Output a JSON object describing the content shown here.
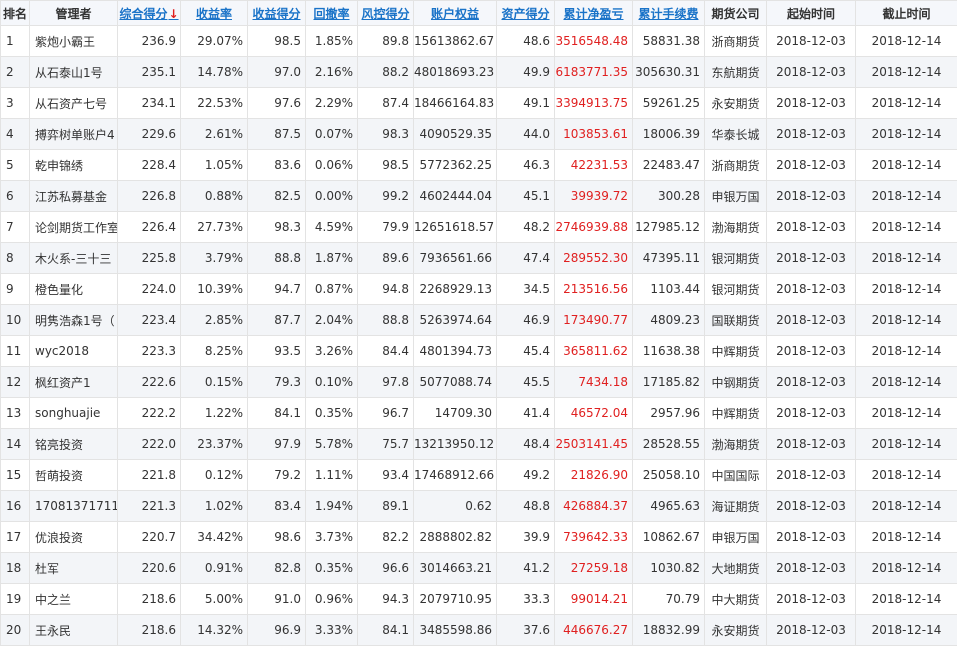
{
  "columns": [
    {
      "label": "排名",
      "sortable": false
    },
    {
      "label": "管理者",
      "sortable": false
    },
    {
      "label": "综合得分",
      "sortable": true,
      "sorted": true
    },
    {
      "label": "收益率",
      "sortable": true
    },
    {
      "label": "收益得分",
      "sortable": true
    },
    {
      "label": "回撤率",
      "sortable": true
    },
    {
      "label": "风控得分",
      "sortable": true
    },
    {
      "label": "账户权益",
      "sortable": true
    },
    {
      "label": "资产得分",
      "sortable": true
    },
    {
      "label": "累计净盈亏",
      "sortable": true
    },
    {
      "label": "累计手续费",
      "sortable": true
    },
    {
      "label": "期货公司",
      "sortable": false
    },
    {
      "label": "起始时间",
      "sortable": false
    },
    {
      "label": "截止时间",
      "sortable": false
    }
  ],
  "sort_arrow": "↓",
  "accent_colors": {
    "link": "#1a73c8",
    "profit": "#e02020",
    "stripe": "#f3f5f8"
  },
  "rows": [
    [
      "1",
      "紫炮小霸王",
      "236.9",
      "29.07%",
      "98.5",
      "1.85%",
      "89.8",
      "15613862.67",
      "48.6",
      "3516548.48",
      "58831.38",
      "浙商期货",
      "2018-12-03",
      "2018-12-14"
    ],
    [
      "2",
      "从石泰山1号",
      "235.1",
      "14.78%",
      "97.0",
      "2.16%",
      "88.2",
      "48018693.23",
      "49.9",
      "6183771.35",
      "305630.31",
      "东航期货",
      "2018-12-03",
      "2018-12-14"
    ],
    [
      "3",
      "从石资产七号",
      "234.1",
      "22.53%",
      "97.6",
      "2.29%",
      "87.4",
      "18466164.83",
      "49.1",
      "3394913.75",
      "59261.25",
      "永安期货",
      "2018-12-03",
      "2018-12-14"
    ],
    [
      "4",
      "搏弈树单账户4",
      "229.6",
      "2.61%",
      "87.5",
      "0.07%",
      "98.3",
      "4090529.35",
      "44.0",
      "103853.61",
      "18006.39",
      "华泰长城",
      "2018-12-03",
      "2018-12-14"
    ],
    [
      "5",
      "乾申锦绣",
      "228.4",
      "1.05%",
      "83.6",
      "0.06%",
      "98.5",
      "5772362.25",
      "46.3",
      "42231.53",
      "22483.47",
      "浙商期货",
      "2018-12-03",
      "2018-12-14"
    ],
    [
      "6",
      "江苏私募基金",
      "226.8",
      "0.88%",
      "82.5",
      "0.00%",
      "99.2",
      "4602444.04",
      "45.1",
      "39939.72",
      "300.28",
      "申银万国",
      "2018-12-03",
      "2018-12-14"
    ],
    [
      "7",
      "论剑期货工作室",
      "226.4",
      "27.73%",
      "98.3",
      "4.59%",
      "79.9",
      "12651618.57",
      "48.2",
      "2746939.88",
      "127985.12",
      "渤海期货",
      "2018-12-03",
      "2018-12-14"
    ],
    [
      "8",
      "木火系-三十三",
      "225.8",
      "3.79%",
      "88.8",
      "1.87%",
      "89.6",
      "7936561.66",
      "47.4",
      "289552.30",
      "47395.11",
      "银河期货",
      "2018-12-03",
      "2018-12-14"
    ],
    [
      "9",
      "橙色量化",
      "224.0",
      "10.39%",
      "94.7",
      "0.87%",
      "94.8",
      "2268929.13",
      "34.5",
      "213516.56",
      "1103.44",
      "银河期货",
      "2018-12-03",
      "2018-12-14"
    ],
    [
      "10",
      "明隽浩森1号（",
      "223.4",
      "2.85%",
      "87.7",
      "2.04%",
      "88.8",
      "5263974.64",
      "46.9",
      "173490.77",
      "4809.23",
      "国联期货",
      "2018-12-03",
      "2018-12-14"
    ],
    [
      "11",
      "wyc2018",
      "223.3",
      "8.25%",
      "93.5",
      "3.26%",
      "84.4",
      "4801394.73",
      "45.4",
      "365811.62",
      "11638.38",
      "中辉期货",
      "2018-12-03",
      "2018-12-14"
    ],
    [
      "12",
      "枫红资产1",
      "222.6",
      "0.15%",
      "79.3",
      "0.10%",
      "97.8",
      "5077088.74",
      "45.5",
      "7434.18",
      "17185.82",
      "中钢期货",
      "2018-12-03",
      "2018-12-14"
    ],
    [
      "13",
      "songhuajie",
      "222.2",
      "1.22%",
      "84.1",
      "0.35%",
      "96.7",
      "14709.30",
      "41.4",
      "46572.04",
      "2957.96",
      "中辉期货",
      "2018-12-03",
      "2018-12-14"
    ],
    [
      "14",
      "铭亮投资",
      "222.0",
      "23.37%",
      "97.9",
      "5.78%",
      "75.7",
      "13213950.12",
      "48.4",
      "2503141.45",
      "28528.55",
      "渤海期货",
      "2018-12-03",
      "2018-12-14"
    ],
    [
      "15",
      "哲萌投资",
      "221.8",
      "0.12%",
      "79.2",
      "1.11%",
      "93.4",
      "17468912.66",
      "49.2",
      "21826.90",
      "25058.10",
      "中国国际",
      "2018-12-03",
      "2018-12-14"
    ],
    [
      "16",
      "17081371711",
      "221.3",
      "1.02%",
      "83.4",
      "1.94%",
      "89.1",
      "0.62",
      "48.8",
      "426884.37",
      "4965.63",
      "海证期货",
      "2018-12-03",
      "2018-12-14"
    ],
    [
      "17",
      "优浪投资",
      "220.7",
      "34.42%",
      "98.6",
      "3.73%",
      "82.2",
      "2888802.82",
      "39.9",
      "739642.33",
      "10862.67",
      "申银万国",
      "2018-12-03",
      "2018-12-14"
    ],
    [
      "18",
      "杜军",
      "220.6",
      "0.91%",
      "82.8",
      "0.35%",
      "96.6",
      "3014663.21",
      "41.2",
      "27259.18",
      "1030.82",
      "大地期货",
      "2018-12-03",
      "2018-12-14"
    ],
    [
      "19",
      "中之兰",
      "218.6",
      "5.00%",
      "91.0",
      "0.96%",
      "94.3",
      "2079710.95",
      "33.3",
      "99014.21",
      "70.79",
      "中大期货",
      "2018-12-03",
      "2018-12-14"
    ],
    [
      "20",
      "王永民",
      "218.6",
      "14.32%",
      "96.9",
      "3.33%",
      "84.1",
      "3485598.86",
      "37.6",
      "446676.27",
      "18832.99",
      "永安期货",
      "2018-12-03",
      "2018-12-14"
    ]
  ]
}
